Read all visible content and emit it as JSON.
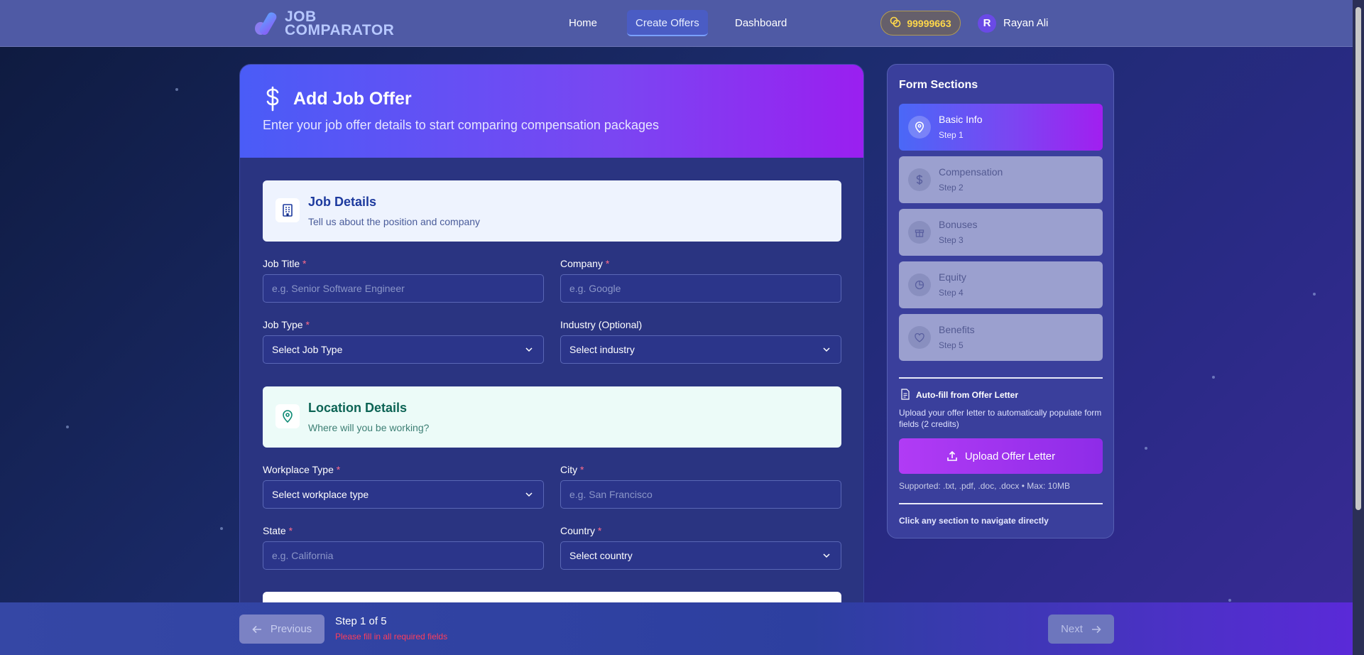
{
  "brand": {
    "line1": "JOB",
    "line2": "COMPARATOR"
  },
  "nav": {
    "links": [
      {
        "label": "Home"
      },
      {
        "label": "Create Offers"
      },
      {
        "label": "Dashboard"
      }
    ],
    "credits": "99999663",
    "user_initial": "R",
    "user_name": "Rayan Ali"
  },
  "header": {
    "title": "Add Job Offer",
    "subtitle": "Enter your job offer details to start comparing compensation packages"
  },
  "job_details": {
    "title": "Job Details",
    "subtitle": "Tell us about the position and company",
    "fields": {
      "job_title": {
        "label": "Job Title",
        "required": "*",
        "placeholder": "e.g. Senior Software Engineer"
      },
      "company": {
        "label": "Company",
        "required": "*",
        "placeholder": "e.g. Google"
      },
      "job_type": {
        "label": "Job Type",
        "required": "*",
        "value": "Select Job Type"
      },
      "industry": {
        "label": "Industry (Optional)",
        "value": "Select industry"
      }
    }
  },
  "location_details": {
    "title": "Location Details",
    "subtitle": "Where will you be working?",
    "fields": {
      "workplace_type": {
        "label": "Workplace Type",
        "required": "*",
        "value": "Select workplace type"
      },
      "city": {
        "label": "City",
        "required": "*",
        "placeholder": "e.g. San Francisco"
      },
      "state": {
        "label": "State",
        "required": "*",
        "placeholder": "e.g. California"
      },
      "country": {
        "label": "Country",
        "required": "*",
        "value": "Select country"
      }
    }
  },
  "sidebar": {
    "title": "Form Sections",
    "steps": [
      {
        "label": "Basic Info",
        "step": "Step 1",
        "icon": "map-pin-icon"
      },
      {
        "label": "Compensation",
        "step": "Step 2",
        "icon": "dollar-icon"
      },
      {
        "label": "Bonuses",
        "step": "Step 3",
        "icon": "gift-icon"
      },
      {
        "label": "Equity",
        "step": "Step 4",
        "icon": "pie-chart-icon"
      },
      {
        "label": "Benefits",
        "step": "Step 5",
        "icon": "heart-icon"
      }
    ],
    "autofill_title": "Auto-fill from Offer Letter",
    "autofill_desc": "Upload your offer letter to automatically populate form fields (2 credits)",
    "upload_label": "Upload Offer Letter",
    "supported": "Supported: .txt, .pdf, .doc, .docx • Max: 10MB",
    "hint": "Click any section to navigate directly"
  },
  "footer": {
    "prev_label": "Previous",
    "step_count": "Step 1 of 5",
    "warning": "Please fill in all required fields",
    "next_label": "Next"
  },
  "colors": {
    "accent": "#4a68f7",
    "purple": "#9a1ff0",
    "credits": "#ffd84a",
    "required": "#ff6b8a"
  }
}
